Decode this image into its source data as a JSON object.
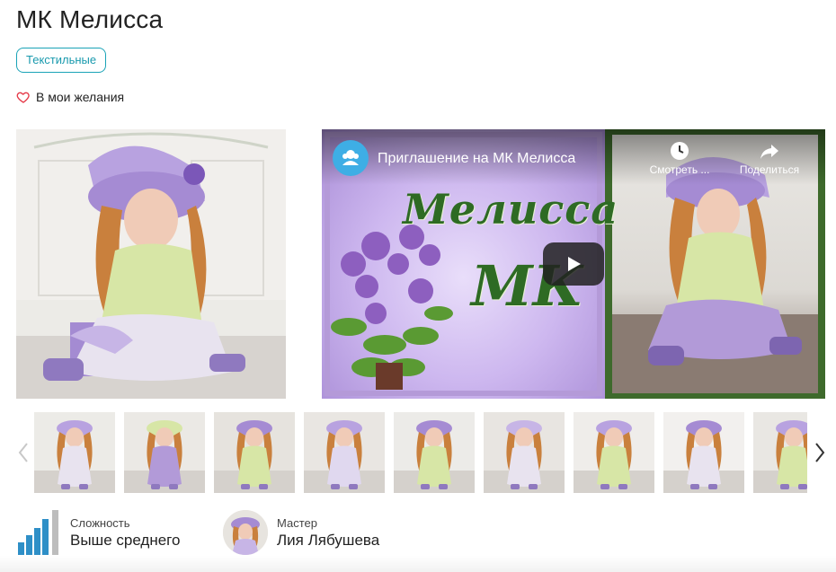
{
  "page": {
    "title": "МК Мелисса",
    "tag_label": "Текстильные",
    "wishlist_label": "В мои желания"
  },
  "video": {
    "title": "Приглашение на МК Мелисса",
    "watch_later_label": "Смотреть ...",
    "share_label": "Поделиться",
    "overlay_line1": "Мелисса",
    "overlay_line2": "МК"
  },
  "thumbnails": [
    {
      "id": "t1"
    },
    {
      "id": "t2"
    },
    {
      "id": "t3"
    },
    {
      "id": "t4"
    },
    {
      "id": "t5"
    },
    {
      "id": "t6"
    },
    {
      "id": "t7"
    },
    {
      "id": "t8"
    },
    {
      "id": "t9"
    }
  ],
  "info": {
    "difficulty_label": "Сложность",
    "difficulty_value": "Выше среднего",
    "master_label": "Мастер",
    "master_value": "Лия Лябушева"
  },
  "colors": {
    "accent": "#1aa3b7",
    "heart": "#e53948",
    "difficulty_active": "#2e8fc7",
    "difficulty_inactive": "#bdbdbd",
    "lavender": "#a58bd3"
  },
  "icons": {
    "wishlist": "heart-icon",
    "video_channel": "channel-logo-icon",
    "watch_later": "clock-icon",
    "share": "share-arrow-icon",
    "play": "play-icon",
    "prev": "chevron-left-icon",
    "next": "chevron-right-icon",
    "difficulty": "difficulty-bars-icon"
  }
}
